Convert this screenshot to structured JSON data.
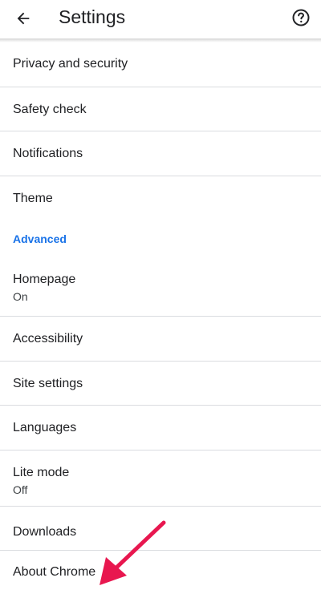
{
  "header": {
    "title": "Settings",
    "back_icon": "arrow-back-icon",
    "help_icon": "help-circle-icon"
  },
  "settings": {
    "items": [
      {
        "label": "Privacy and security"
      },
      {
        "label": "Safety check"
      },
      {
        "label": "Notifications"
      },
      {
        "label": "Theme"
      }
    ],
    "advanced_header": "Advanced",
    "advanced_items": [
      {
        "label": "Homepage",
        "summary": "On"
      },
      {
        "label": "Accessibility"
      },
      {
        "label": "Site settings"
      },
      {
        "label": "Languages"
      },
      {
        "label": "Lite mode",
        "summary": "Off"
      },
      {
        "label": "Downloads"
      },
      {
        "label": "About Chrome"
      }
    ]
  },
  "colors": {
    "accent": "#1a73e8",
    "annotation_arrow": "#e8174f"
  }
}
